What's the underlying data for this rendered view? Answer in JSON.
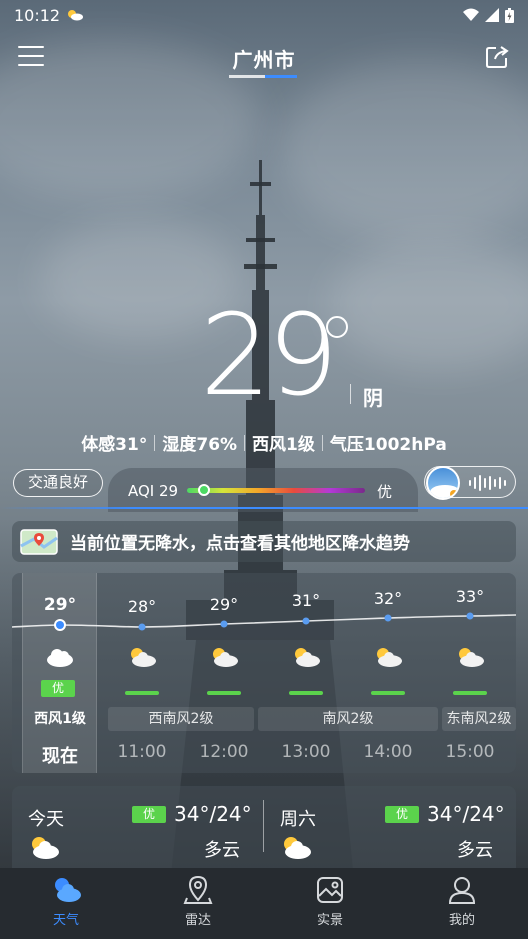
{
  "status_bar": {
    "time": "10:12"
  },
  "header": {
    "city": "广州市",
    "menu_icon": "hamburger-menu-icon",
    "share_icon": "share-icon"
  },
  "current": {
    "temperature": "29",
    "condition": "阴",
    "details": [
      "体感31°",
      "湿度76%",
      "西风1级",
      "气压1002hPa"
    ]
  },
  "traffic": {
    "label": "交通良好"
  },
  "aqi": {
    "label": "AQI 29",
    "level": "优",
    "value": 29
  },
  "notice": {
    "text": "当前位置无降水，点击查看其他地区降水趋势"
  },
  "hourly": {
    "items": [
      {
        "time": "现在",
        "temp": "29°",
        "icon": "cloudy-icon",
        "aqi": "优"
      },
      {
        "time": "11:00",
        "temp": "28°",
        "icon": "partly-cloudy-icon"
      },
      {
        "time": "12:00",
        "temp": "29°",
        "icon": "partly-cloudy-icon"
      },
      {
        "time": "13:00",
        "temp": "31°",
        "icon": "partly-cloudy-icon"
      },
      {
        "time": "14:00",
        "temp": "32°",
        "icon": "partly-cloudy-icon"
      },
      {
        "time": "15:00",
        "temp": "33°",
        "icon": "partly-cloudy-icon"
      }
    ],
    "winds": [
      "西风1级",
      "西南风2级",
      "南风2级",
      "东南风2级"
    ]
  },
  "daily": [
    {
      "day": "今天",
      "aqi": "优",
      "temp": "34°/24°",
      "condition": "多云",
      "icon": "partly-cloudy-day-icon"
    },
    {
      "day": "周六",
      "aqi": "优",
      "temp": "34°/24°",
      "condition": "多云",
      "icon": "partly-cloudy-day-icon"
    }
  ],
  "nav": [
    {
      "label": "天气",
      "icon": "weather-icon",
      "active": true
    },
    {
      "label": "雷达",
      "icon": "radar-location-icon"
    },
    {
      "label": "实景",
      "icon": "photo-scene-icon"
    },
    {
      "label": "我的",
      "icon": "profile-icon"
    }
  ],
  "colors": {
    "accent": "#3c8cff",
    "aqi_good": "#5bd34c",
    "nav_bg": "#262b30"
  }
}
